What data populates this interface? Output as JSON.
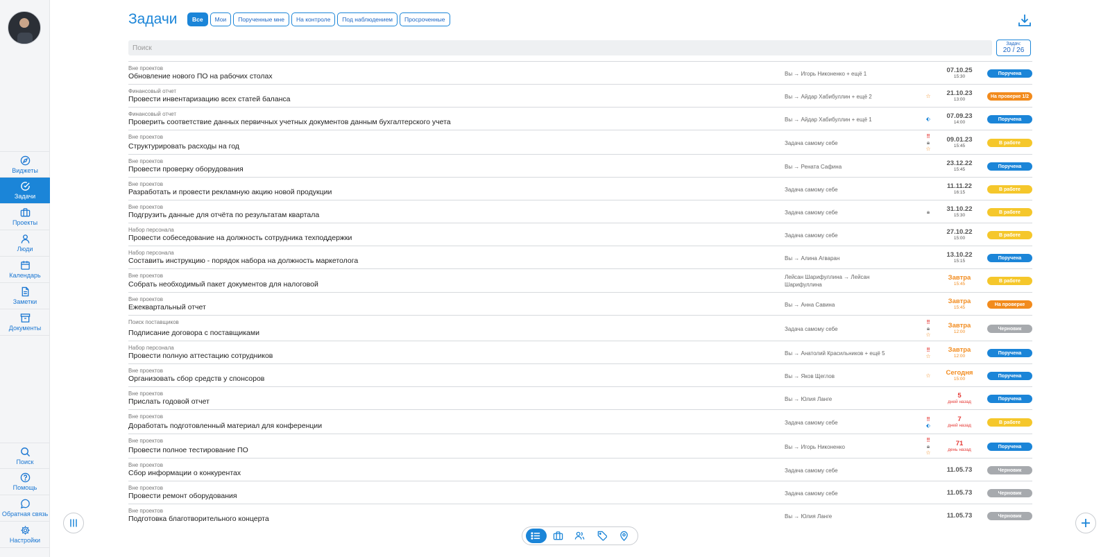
{
  "sidebar": {
    "nav": [
      {
        "label": "Виджеты",
        "icon": "compass-icon",
        "active": false
      },
      {
        "label": "Задачи",
        "icon": "check-circle-icon",
        "active": true
      },
      {
        "label": "Проекты",
        "icon": "briefcase-icon",
        "active": false
      },
      {
        "label": "Люди",
        "icon": "person-icon",
        "active": false
      },
      {
        "label": "Календарь",
        "icon": "calendar-icon",
        "active": false
      },
      {
        "label": "Заметки",
        "icon": "note-icon",
        "active": false
      },
      {
        "label": "Документы",
        "icon": "archive-icon",
        "active": false
      }
    ],
    "bottom": [
      {
        "label": "Поиск",
        "icon": "search-icon"
      },
      {
        "label": "Помощь",
        "icon": "help-icon"
      },
      {
        "label": "Обратная связь",
        "icon": "chat-icon"
      },
      {
        "label": "Настройки",
        "icon": "gear-icon"
      }
    ]
  },
  "header": {
    "title": "Задачи",
    "filters": [
      "Все",
      "Мои",
      "Порученные мне",
      "На контроле",
      "Под наблюдением",
      "Просроченные"
    ],
    "active_filter": "Все"
  },
  "search": {
    "placeholder": "Поиск"
  },
  "counter": {
    "label": "Задач:",
    "value": "20 / 26"
  },
  "colors": {
    "accent": "#1b85d8",
    "status_assigned": "#1b85d8",
    "status_in_progress": "#f5c72b",
    "status_review": "#f28b1d",
    "status_draft": "#a7aaae",
    "overdue": "#e53935"
  },
  "tasks": [
    {
      "project": "Вне проектов",
      "name": "Обновление нового ПО на рабочих столах",
      "assign": "Вы → Игорь Никоненко + ещё 1",
      "icons": [],
      "date": "07.10.25",
      "time": "15:30",
      "date_style": "normal",
      "status": "Поручена",
      "status_type": "assigned"
    },
    {
      "project": "Финансовый отчет",
      "name": "Провести инвентаризацию всех статей баланса",
      "assign": "Вы → Айдар Хабибуллин + ещё 2",
      "icons": [
        "star"
      ],
      "date": "21.10.23",
      "time": "13:00",
      "date_style": "normal",
      "status": "На проверке 1/2",
      "status_type": "review"
    },
    {
      "project": "Финансовый отчет",
      "name": "Проверить соответствие данных первичных учетных документов данным бухгалтерского учета",
      "assign": "Вы → Айдар Хабибуллин + ещё 1",
      "icons": [
        "tag"
      ],
      "date": "07.09.23",
      "time": "14:00",
      "date_style": "normal",
      "status": "Поручена",
      "status_type": "assigned"
    },
    {
      "project": "Вне проектов",
      "name": "Структурировать расходы на год",
      "assign": "Задача самому себе",
      "icons": [
        "exclaim",
        "lock",
        "star"
      ],
      "date": "09.01.23",
      "time": "15:45",
      "date_style": "normal",
      "status": "В работе",
      "status_type": "progress"
    },
    {
      "project": "Вне проектов",
      "name": "Провести проверку оборудования",
      "assign": "Вы → Рената Сафина",
      "icons": [],
      "date": "23.12.22",
      "time": "15:45",
      "date_style": "normal",
      "status": "Поручена",
      "status_type": "assigned"
    },
    {
      "project": "Вне проектов",
      "name": "Разработать и провести рекламную акцию новой продукции",
      "assign": "Задача самому себе",
      "icons": [],
      "date": "11.11.22",
      "time": "16:15",
      "date_style": "normal",
      "status": "В работе",
      "status_type": "progress"
    },
    {
      "project": "Вне проектов",
      "name": "Подгрузить данные для отчёта по результатам квартала",
      "assign": "Задача самому себе",
      "icons": [
        "lock"
      ],
      "date": "31.10.22",
      "time": "15:30",
      "date_style": "normal",
      "status": "В работе",
      "status_type": "progress"
    },
    {
      "project": "Набор персонала",
      "name": "Провести собеседование на должность сотрудника техподдержки",
      "assign": "Задача самому себе",
      "icons": [],
      "date": "27.10.22",
      "time": "15:00",
      "date_style": "normal",
      "status": "В работе",
      "status_type": "progress"
    },
    {
      "project": "Набор персонала",
      "name": "Составить инструкцию - порядок набора на должность маркетолога",
      "assign": "Вы → Алина Агваран",
      "icons": [],
      "date": "13.10.22",
      "time": "15:15",
      "date_style": "normal",
      "status": "Поручена",
      "status_type": "assigned"
    },
    {
      "project": "Вне проектов",
      "name": "Собрать необходимый пакет документов для налоговой",
      "assign": "Лейсан Шарифуллина → Лейсан Шарифуллина",
      "icons": [],
      "date": "Завтра",
      "time": "15:45",
      "date_style": "warn",
      "status": "В работе",
      "status_type": "progress"
    },
    {
      "project": "Вне проектов",
      "name": "Ежеквартальный отчет",
      "assign": "Вы → Анна Савина",
      "icons": [],
      "date": "Завтра",
      "time": "15:45",
      "date_style": "warn",
      "status": "На проверке",
      "status_type": "review"
    },
    {
      "project": "Поиск поставщиков",
      "name": "Подписание договора с поставщиками",
      "assign": "Задача самому себе",
      "icons": [
        "exclaim",
        "lock",
        "star"
      ],
      "date": "Завтра",
      "time": "12:00",
      "date_style": "warn",
      "status": "Черновик",
      "status_type": "draft"
    },
    {
      "project": "Набор персонала",
      "name": "Провести полную аттестацию сотрудников",
      "assign": "Вы → Анатолий Красильников + ещё 5",
      "icons": [
        "exclaim",
        "star"
      ],
      "date": "Завтра",
      "time": "12:00",
      "date_style": "warn",
      "status": "Поручена",
      "status_type": "assigned"
    },
    {
      "project": "Вне проектов",
      "name": "Организовать сбор средств у спонсоров",
      "assign": "Вы → Яков Щеглов",
      "icons": [
        "star"
      ],
      "date": "Сегодня",
      "time": "15:00",
      "date_style": "warn",
      "status": "Поручена",
      "status_type": "assigned"
    },
    {
      "project": "Вне проектов",
      "name": "Прислать годовой отчет",
      "assign": "Вы → Юлия Ланге",
      "icons": [],
      "date": "5",
      "time": "дней назад",
      "date_style": "red",
      "status": "Поручена",
      "status_type": "assigned"
    },
    {
      "project": "Вне проектов",
      "name": "Доработать подготовленный материал для конференции",
      "assign": "Задача самому себе",
      "icons": [
        "exclaim",
        "tag"
      ],
      "date": "7",
      "time": "дней назад",
      "date_style": "red",
      "status": "В работе",
      "status_type": "progress"
    },
    {
      "project": "Вне проектов",
      "name": "Провести полное тестирование ПО",
      "assign": "Вы → Игорь Никоненко",
      "icons": [
        "exclaim",
        "lock",
        "star"
      ],
      "date": "71",
      "time": "день назад",
      "date_style": "red",
      "status": "Поручена",
      "status_type": "assigned"
    },
    {
      "project": "Вне проектов",
      "name": "Сбор информации о конкурентах",
      "assign": "Задача самому себе",
      "icons": [],
      "date": "11.05.73",
      "time": "",
      "date_style": "normal",
      "status": "Черновик",
      "status_type": "draft"
    },
    {
      "project": "Вне проектов",
      "name": "Провести ремонт оборудования",
      "assign": "Задача самому себе",
      "icons": [],
      "date": "11.05.73",
      "time": "",
      "date_style": "normal",
      "status": "Черновик",
      "status_type": "draft"
    },
    {
      "project": "Вне проектов",
      "name": "Подготовка благотворительного концерта",
      "assign": "Вы → Юлия Ланге",
      "icons": [],
      "date": "11.05.73",
      "time": "",
      "date_style": "normal",
      "status": "Черновик",
      "status_type": "draft"
    }
  ],
  "viewbar": {
    "buttons": [
      "list-icon",
      "briefcase-icon",
      "people-icon",
      "tag-icon",
      "location-pin-icon"
    ],
    "active": "list-icon"
  }
}
